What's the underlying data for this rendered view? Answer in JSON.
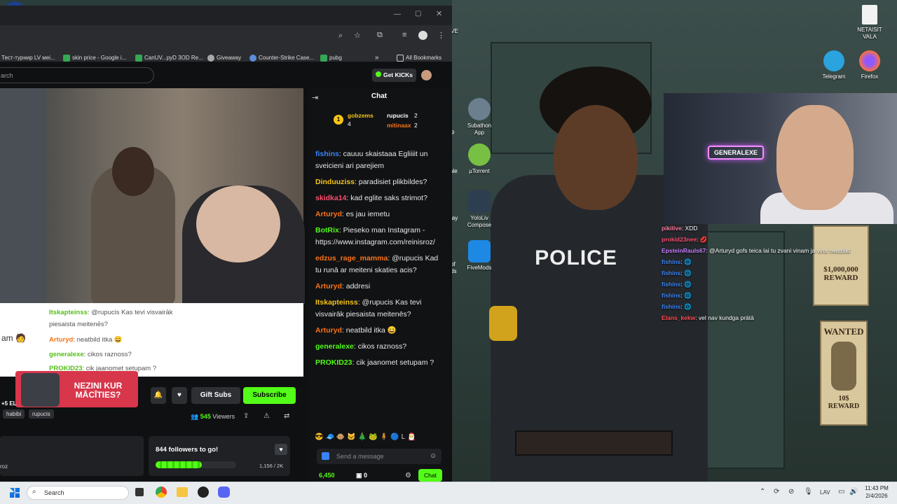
{
  "desktop": {
    "icons": [
      {
        "label": "NETAISIT\nVALA",
        "name": "file-icon"
      },
      {
        "label": "Telegram",
        "name": "telegram-icon"
      },
      {
        "label": "Firefox",
        "name": "firefox-icon"
      },
      {
        "label": "Subathon\nApp",
        "name": "subathon-icon"
      },
      {
        "label": "µTorrent",
        "name": "utorrent-icon"
      },
      {
        "label": "YoloLiv\nCompose",
        "name": "yololiv-icon"
      },
      {
        "label": "FiveMods",
        "name": "fivemods-icon"
      }
    ],
    "partial_labels": [
      "IVE",
      "p",
      "ale",
      "lay",
      "of",
      "ds"
    ]
  },
  "browser": {
    "bookmarks": [
      "Тест-турнир LV мei...",
      "skin price - Google i...",
      "CanUV...pyD 3OD Re...",
      "Giveaway",
      "Counter-Strike Case...",
      "pubg"
    ],
    "bookmarks_more": "»",
    "all_bookmarks": "All Bookmarks"
  },
  "kick": {
    "search_placeholder": "arch",
    "get_kicks": "Get KICKs",
    "overlay": {
      "lines": [
        {
          "user": "Itskapteinss",
          "text": ": @rupucis Kas tevi visvairāk"
        },
        {
          "user": "",
          "text": "piesaista meitenēs?"
        },
        {
          "user": "Arturyd",
          "text": ": neatbild itka 😄"
        },
        {
          "user": "generalexe",
          "text": ": cikos raznoss?"
        },
        {
          "user": "PROKID23",
          "text": ": cik jaanomet setupam ?"
        }
      ],
      "left_text": "am 🧑"
    },
    "promo": "NEZINI KUR MĀCĪTIES?",
    "buttons": {
      "gift": "Gift Subs",
      "subscribe": "Subscribe"
    },
    "plus_text": "+5 EL",
    "tags": [
      "habibi",
      "rupucis"
    ],
    "viewers_count": "545",
    "viewers_label": "Viewers",
    "followers_goal": "844 followers to go!",
    "followers_progress": "1,156 / 2K",
    "followers_fraction": 0.578,
    "lower_text": "roz"
  },
  "chat": {
    "title": "Chat",
    "leaders": {
      "rank1": {
        "user": "gobzems",
        "count": "4"
      },
      "rank2": {
        "user": "rupucis",
        "count": "2"
      },
      "rank3": {
        "user": "mitinaax",
        "count": "2"
      }
    },
    "messages": [
      {
        "user": "fishins",
        "color": "#3b82f6",
        "text": ": cauuu skaistaaa Egliiiit un sveicieni ari parejiem"
      },
      {
        "user": "Dinduuziss",
        "color": "#f5c518",
        "text": ": paradisiet plikbildes?"
      },
      {
        "user": "skidka14",
        "color": "#ff4d6d",
        "text": ": kad eglite saks strimot?"
      },
      {
        "user": "Arturyd",
        "color": "#f97316",
        "text": ": es jau iemetu"
      },
      {
        "user": "BotRix",
        "color": "#53fc18",
        "text": ": Pieseko man Instagram - https://www.instagram.com/reinisroz/"
      },
      {
        "user": "edzus_rage_mamma",
        "color": "#f97316",
        "text": ": @rupucis Kad tu runā ar meiteni skaties acis?"
      },
      {
        "user": "Arturyd",
        "color": "#f97316",
        "text": ": addresi"
      },
      {
        "user": "Itskapteinss",
        "color": "#f5c518",
        "text": ": @rupucis Kas tevi visvairāk piesaista meitenēs?"
      },
      {
        "user": "Arturyd",
        "color": "#f97316",
        "text": ": neatbild itka 😄"
      },
      {
        "user": "generalexe",
        "color": "#53fc18",
        "text": ": cikos raznoss?"
      },
      {
        "user": "PROKID23",
        "color": "#53fc18",
        "text": ": cik jaanomet setupam ?"
      }
    ],
    "send_placeholder": "Send a message",
    "points": "6,450",
    "tickets": "0",
    "chat_button": "Chat"
  },
  "game": {
    "police_text": "POLICE",
    "poster_reward": "$1,000,000\nREWARD",
    "wanted": "WANTED",
    "wanted_reward": "10$\nREWARD"
  },
  "webcam": {
    "neon_sign": "GENERALEXE"
  },
  "stream_chat": [
    {
      "user": "pikilive",
      "color": "#ff7aa0",
      "text": ": XDD"
    },
    {
      "user": "prokid23nee",
      "color": "#ff4d6d",
      "text": ": 💋"
    },
    {
      "user": "EpsteinRauls67",
      "color": "#c77dff",
      "text": ": @Arturyd gofs teica lai tu zvani vinam ja vins neatbild"
    },
    {
      "user": "fishins",
      "color": "#3b82f6",
      "text": ": 🌐"
    },
    {
      "user": "fishins",
      "color": "#3b82f6",
      "text": ": 🌐"
    },
    {
      "user": "fishins",
      "color": "#3b82f6",
      "text": ": 🌐"
    },
    {
      "user": "fishins",
      "color": "#3b82f6",
      "text": ": 🌐"
    },
    {
      "user": "fishins",
      "color": "#3b82f6",
      "text": ": 🌐"
    },
    {
      "user": "Elans_kekw",
      "color": "#ff4d4d",
      "text": ": vel nav kundga prātā"
    }
  ],
  "taskbar": {
    "search": "Search",
    "language": "LAV",
    "time": "11:43 PM",
    "date": "2/4/2026"
  },
  "topleft_badge": "X5"
}
